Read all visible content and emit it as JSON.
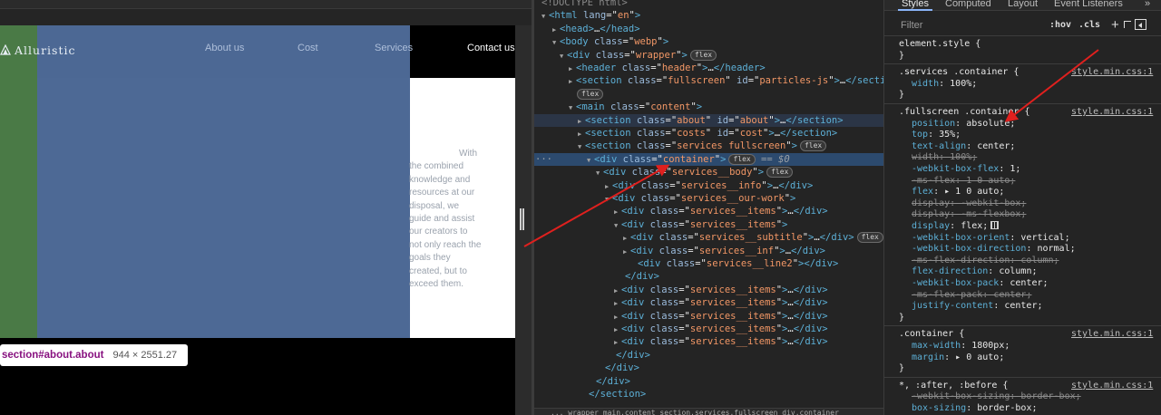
{
  "viewport": {
    "logo": "Alluristic",
    "nav": {
      "about": "About us",
      "cost": "Cost",
      "services": "Services",
      "contact": "Contact us"
    },
    "services_text_first": "With",
    "services_text_rest": "the combined knowledge and resources at our disposal, we guide and assist our creators to not only reach the goals they created, but to exceed them.",
    "tooltip": {
      "selector": "section#about.about",
      "size": "944 × 2551.27"
    }
  },
  "elements": {
    "lines": [
      {
        "t": "<!DOCTYPE html>"
      },
      {
        "tag": "html",
        "attrs": [
          [
            "lang",
            "en"
          ]
        ],
        "open": true
      },
      {
        "tag": "head",
        "collapsed": true,
        "close": "</head>"
      },
      {
        "tag": "body",
        "attrs": [
          [
            "class",
            "webp"
          ]
        ]
      },
      {
        "tag": "div",
        "attrs": [
          [
            "class",
            "wrapper"
          ]
        ],
        "badge": "flex"
      },
      {
        "tag": "header",
        "attrs": [
          [
            "class",
            "header"
          ]
        ],
        "collapsed": true,
        "close": "</header>"
      },
      {
        "tag": "section",
        "attrs": [
          [
            "class",
            "fullscreen"
          ],
          [
            "id",
            "particles-js"
          ]
        ],
        "collapsed": true,
        "close": "</section>"
      },
      {
        "badge_line": "flex"
      },
      {
        "tag": "main",
        "attrs": [
          [
            "class",
            "content"
          ]
        ]
      },
      {
        "tag": "section",
        "attrs": [
          [
            "class",
            "about"
          ],
          [
            "id",
            "about"
          ]
        ],
        "collapsed": true,
        "close": "</section>"
      },
      {
        "tag": "section",
        "attrs": [
          [
            "class",
            "costs"
          ],
          [
            "id",
            "cost"
          ]
        ],
        "collapsed": true,
        "close": "</section>"
      },
      {
        "tag": "section",
        "attrs": [
          [
            "class",
            "services fullscreen"
          ]
        ],
        "badge": "flex"
      },
      {
        "tag": "div",
        "attrs": [
          [
            "class",
            "container"
          ]
        ],
        "badge": "flex",
        "dollar": "== $0"
      },
      {
        "tag": "div",
        "attrs": [
          [
            "class",
            "services__body"
          ]
        ],
        "badge": "flex"
      },
      {
        "tag": "div",
        "attrs": [
          [
            "class",
            "services__info"
          ]
        ],
        "collapsed": true,
        "close": "</div>"
      },
      {
        "tag": "div",
        "attrs": [
          [
            "class",
            "services__our-work"
          ]
        ]
      },
      {
        "tag": "div",
        "attrs": [
          [
            "class",
            "services__items"
          ]
        ],
        "collapsed": true,
        "close": "</div>"
      },
      {
        "tag": "div",
        "attrs": [
          [
            "class",
            "services__items"
          ]
        ]
      },
      {
        "tag": "div",
        "attrs": [
          [
            "class",
            "services__subtitle"
          ]
        ],
        "collapsed": true,
        "close": "</div>",
        "badge": "flex"
      },
      {
        "tag": "div",
        "attrs": [
          [
            "class",
            "services__inf"
          ]
        ],
        "collapsed": true,
        "close": "</div>"
      },
      {
        "tag": "div",
        "attrs": [
          [
            "class",
            "services__line2"
          ]
        ],
        "close": "</div>"
      },
      {
        "t": "</div>"
      },
      {
        "tag": "div",
        "attrs": [
          [
            "class",
            "services__items"
          ]
        ],
        "collapsed": true,
        "close": "</div>"
      },
      {
        "tag": "div",
        "attrs": [
          [
            "class",
            "services__items"
          ]
        ],
        "collapsed": true,
        "close": "</div>"
      },
      {
        "tag": "div",
        "attrs": [
          [
            "class",
            "services__items"
          ]
        ],
        "collapsed": true,
        "close": "</div>"
      },
      {
        "tag": "div",
        "attrs": [
          [
            "class",
            "services__items"
          ]
        ],
        "collapsed": true,
        "close": "</div>"
      },
      {
        "tag": "div",
        "attrs": [
          [
            "class",
            "services__items"
          ]
        ],
        "collapsed": true,
        "close": "</div>"
      },
      {
        "t": "</div>"
      },
      {
        "t": "</div>"
      },
      {
        "t": "</div>"
      },
      {
        "t": "</section>"
      }
    ],
    "footer": "... wrapper   main.content   section.services.fullscreen   div.container"
  },
  "styles": {
    "tabs": {
      "styles": "Styles",
      "computed": "Computed",
      "layout": "Layout",
      "listeners": "Event Listeners",
      "more": "»"
    },
    "filter": {
      "placeholder": "Filter",
      "hov": ":hov",
      "cls": ".cls",
      "plus": "+"
    },
    "rules": [
      {
        "selector": "element.style {",
        "props": [],
        "close": "}"
      },
      {
        "selector": ".services .container {",
        "source": "style.min.css:1",
        "props": [
          [
            "width",
            "100%;",
            false
          ]
        ],
        "close": "}"
      },
      {
        "selector": ".fullscreen .container {",
        "source": "style.min.css:1",
        "props": [
          [
            "position",
            "absolute;",
            false
          ],
          [
            "top",
            "35%;",
            false
          ],
          [
            "text-align",
            "center;",
            false
          ],
          [
            "width",
            "100%;",
            true
          ],
          [
            "-webkit-box-flex",
            "1;",
            false
          ],
          [
            "-ms-flex",
            "1 0 auto;",
            true
          ],
          [
            "flex",
            "▸ 1 0 auto;",
            false
          ],
          [
            "display",
            "-webkit-box;",
            true
          ],
          [
            "display",
            "-ms-flexbox;",
            true
          ],
          [
            "display",
            "flex;",
            false
          ],
          [
            "-webkit-box-orient",
            "vertical;",
            false
          ],
          [
            "-webkit-box-direction",
            "normal;",
            false
          ],
          [
            "-ms-flex-direction",
            "column;",
            true
          ],
          [
            "flex-direction",
            "column;",
            false
          ],
          [
            "-webkit-box-pack",
            "center;",
            false
          ],
          [
            "-ms-flex-pack",
            "center;",
            true
          ],
          [
            "justify-content",
            "center;",
            false
          ]
        ],
        "close": "}"
      },
      {
        "selector": ".container {",
        "source": "style.min.css:1",
        "props": [
          [
            "max-width",
            "1800px;",
            false
          ],
          [
            "margin",
            "▸ 0 auto;",
            false
          ]
        ],
        "close": "}"
      },
      {
        "selector": "*, :after, :before {",
        "source": "style.min.css:1",
        "props": [
          [
            "-webkit-box-sizing",
            "border-box;",
            true
          ],
          [
            "box-sizing",
            "border-box;",
            false
          ]
        ],
        "close": ""
      }
    ]
  },
  "colors": {
    "selected_row": "#2c4a6e",
    "overlay_blue": "#4e6b99",
    "overlay_green": "#4a7a46",
    "arrow": "#e0201e"
  }
}
